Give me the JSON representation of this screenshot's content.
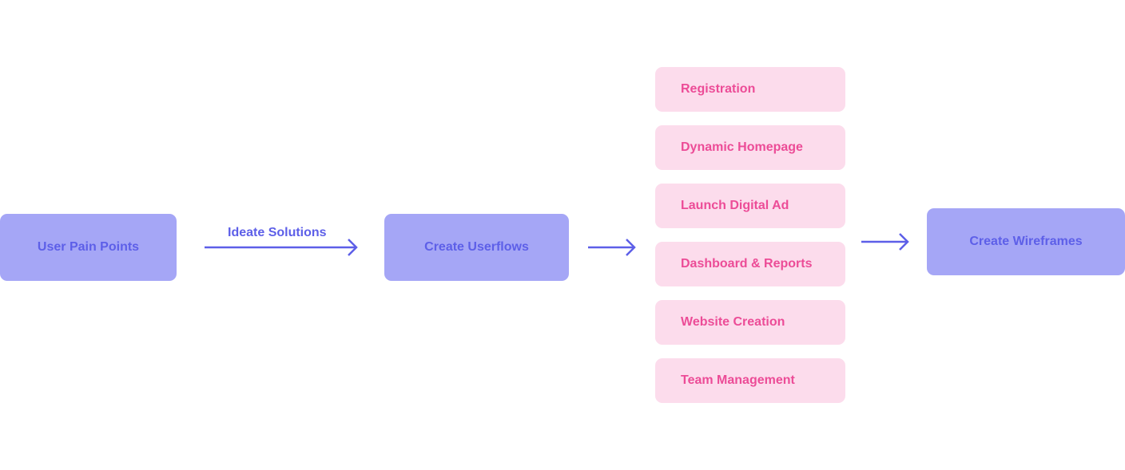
{
  "colors": {
    "primary_box": "#a5a6f6",
    "primary_text": "#5d5fe8",
    "feature_box": "#fcdcec",
    "feature_text": "#ec4c97",
    "arrow": "#5d5fe8"
  },
  "nodes": {
    "pain_points": "User Pain Points",
    "userflows": "Create Userflows",
    "wireframes": "Create Wireframes"
  },
  "edges": {
    "ideate": "Ideate Solutions"
  },
  "features": [
    "Registration",
    "Dynamic Homepage",
    "Launch Digital Ad",
    "Dashboard & Reports",
    "Website Creation",
    "Team Management"
  ]
}
